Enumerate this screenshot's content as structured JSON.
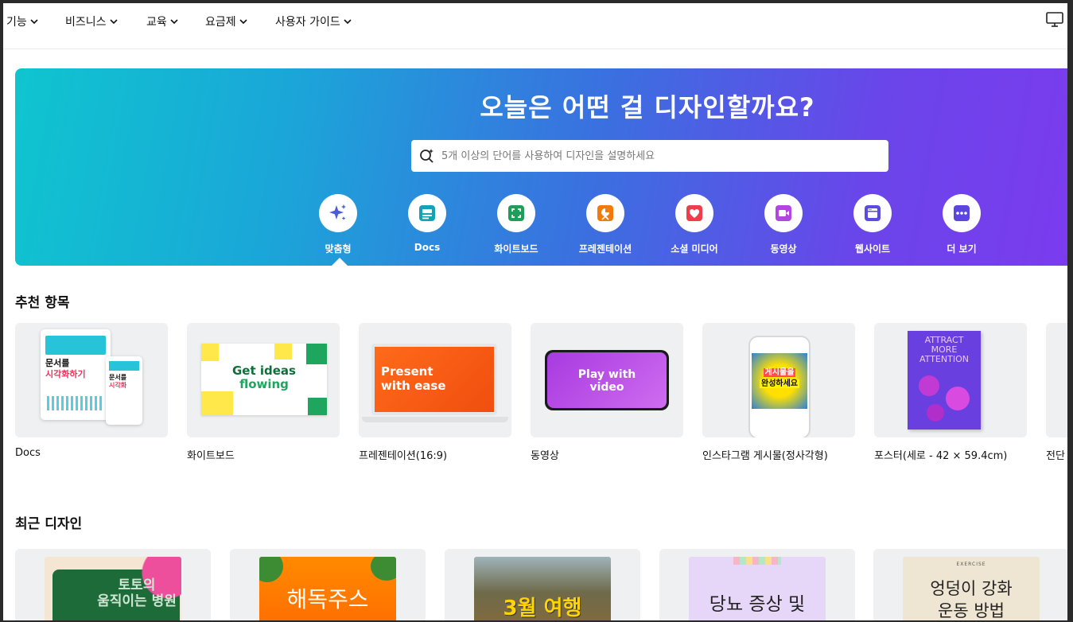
{
  "nav": {
    "items": [
      "기능",
      "비즈니스",
      "교육",
      "요금제",
      "사용자 가이드"
    ]
  },
  "hero": {
    "title": "오늘은 어떤 걸 디자인할까요?",
    "search_placeholder": "5개 이상의 단어를 사용하여 디자인을 설명하세요",
    "categories": [
      {
        "label": "맞춤형",
        "icon": "sparkle-icon",
        "color": "#4b5bdc"
      },
      {
        "label": "Docs",
        "icon": "docs-icon",
        "color": "#13a3b5"
      },
      {
        "label": "화이트보드",
        "icon": "whiteboard-icon",
        "color": "#1e9e5a"
      },
      {
        "label": "프레젠테이션",
        "icon": "presentation-icon",
        "color": "#f17a0a"
      },
      {
        "label": "소셜 미디어",
        "icon": "heart-icon",
        "color": "#ee3d4b"
      },
      {
        "label": "동영상",
        "icon": "video-icon",
        "color": "#b146e0"
      },
      {
        "label": "웹사이트",
        "icon": "website-icon",
        "color": "#5a4ce0"
      },
      {
        "label": "더 보기",
        "icon": "more-icon",
        "color": "#5b47df"
      }
    ]
  },
  "recommended": {
    "title": "추천 항목",
    "items": [
      {
        "label": "Docs",
        "thumb_text_1": "문서를",
        "thumb_text_2": "시각화하기"
      },
      {
        "label": "화이트보드",
        "thumb_text_1": "Get ideas",
        "thumb_text_2": "flowing"
      },
      {
        "label": "프레젠테이션(16:9)",
        "thumb_text_1": "Present",
        "thumb_text_2": "with ease"
      },
      {
        "label": "동영상",
        "thumb_text_1": "Play with",
        "thumb_text_2": "video"
      },
      {
        "label": "인스타그램 게시물(정사각형)",
        "thumb_text_1": "게시물을",
        "thumb_text_2": "완성하세요"
      },
      {
        "label": "포스터(세로 - 42 × 59.4cm)",
        "thumb_text_1": "ATTRACT",
        "thumb_text_2": "MORE",
        "thumb_text_3": "ATTENTION"
      },
      {
        "label": "전단"
      }
    ]
  },
  "recent": {
    "title": "최근 디자인",
    "items": [
      {
        "text": "토토의 움직이는 병원"
      },
      {
        "text": "해독주스"
      },
      {
        "text": "3월 여행"
      },
      {
        "text": "당뇨 증상 및"
      },
      {
        "text": "엉덩이 강화 운동 방법",
        "small": "EXERCISE"
      }
    ]
  }
}
